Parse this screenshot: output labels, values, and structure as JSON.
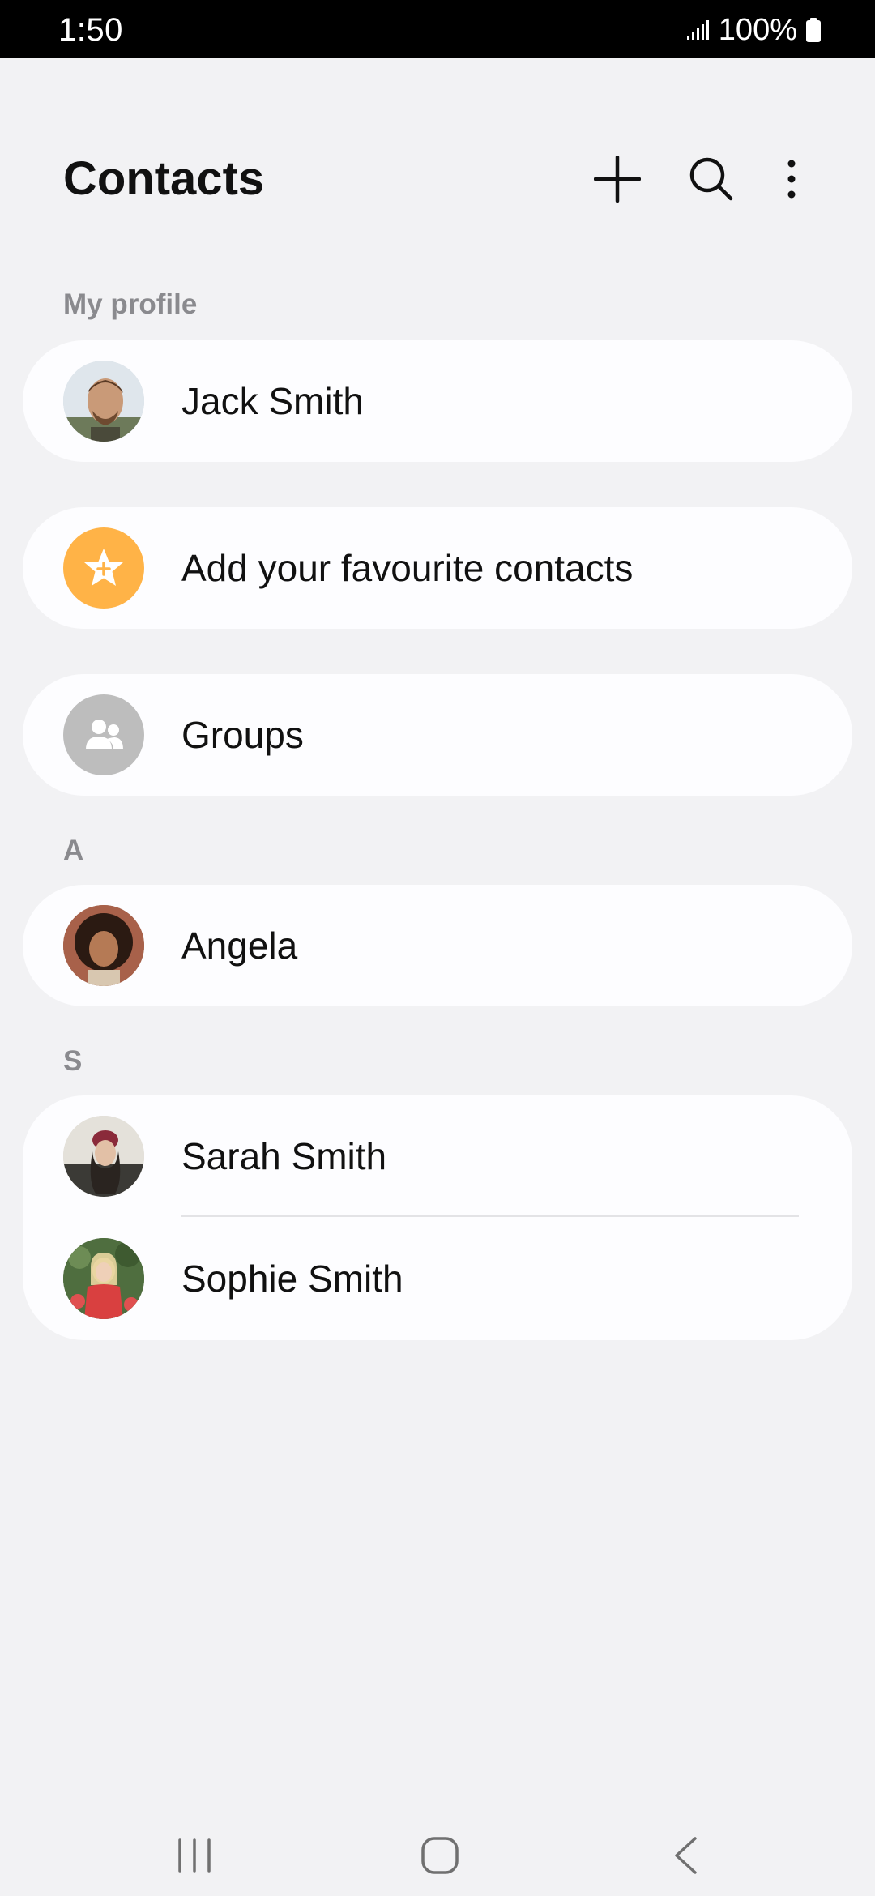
{
  "status_bar": {
    "time": "1:50",
    "battery": "100%",
    "icons": [
      "signal-icon",
      "battery-icon"
    ]
  },
  "header": {
    "title": "Contacts",
    "actions": [
      {
        "name": "add-contact-button",
        "icon": "plus-icon"
      },
      {
        "name": "search-button",
        "icon": "search-icon"
      },
      {
        "name": "more-options-button",
        "icon": "more-vertical-icon"
      }
    ]
  },
  "my_profile": {
    "section_label": "My profile",
    "name": "Jack Smith"
  },
  "favourites": {
    "label": "Add your favourite contacts",
    "icon": "star-plus-icon",
    "color": "#ffb347"
  },
  "groups": {
    "label": "Groups",
    "icon": "group-people-icon",
    "color": "#bdbdbd"
  },
  "sections": [
    {
      "letter": "A",
      "contacts": [
        {
          "name": "Angela"
        }
      ]
    },
    {
      "letter": "S",
      "contacts": [
        {
          "name": "Sarah Smith"
        },
        {
          "name": "Sophie Smith"
        }
      ]
    }
  ],
  "nav_bar": {
    "buttons": [
      {
        "name": "recent-apps-button",
        "icon": "recents-icon"
      },
      {
        "name": "home-button",
        "icon": "home-icon"
      },
      {
        "name": "back-button",
        "icon": "back-icon"
      }
    ]
  }
}
